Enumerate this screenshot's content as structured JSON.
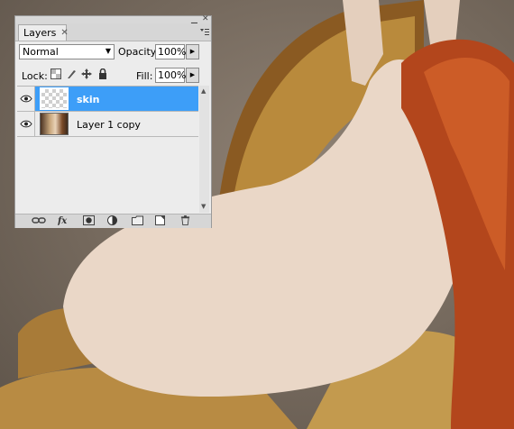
{
  "panel": {
    "tab_label": "Layers",
    "tab_close_glyph": "✕",
    "minimize_glyph": "▁",
    "close_glyph": "✕",
    "menu_icon": "panel-menu-icon"
  },
  "blend": {
    "mode": "Normal",
    "opacity_label": "Opacity:",
    "opacity_value": "100%",
    "fill_label": "Fill:",
    "fill_value": "100%"
  },
  "lock": {
    "label": "Lock:",
    "icons": [
      "lock-transparent-icon",
      "lock-brush-icon",
      "lock-move-icon",
      "lock-all-icon"
    ]
  },
  "layers": [
    {
      "name": "skin",
      "selected": true,
      "visible": true,
      "thumb": "transparent"
    },
    {
      "name": "Layer 1 copy",
      "selected": false,
      "visible": true,
      "thumb": "photo"
    }
  ],
  "footer_icons": [
    "link-layers-icon",
    "fx-icon",
    "layer-mask-icon",
    "adjustment-layer-icon",
    "new-group-icon",
    "new-layer-icon",
    "trash-icon"
  ],
  "colors": {
    "selection": "#3d9ef8",
    "panel_bg": "#ececec"
  }
}
